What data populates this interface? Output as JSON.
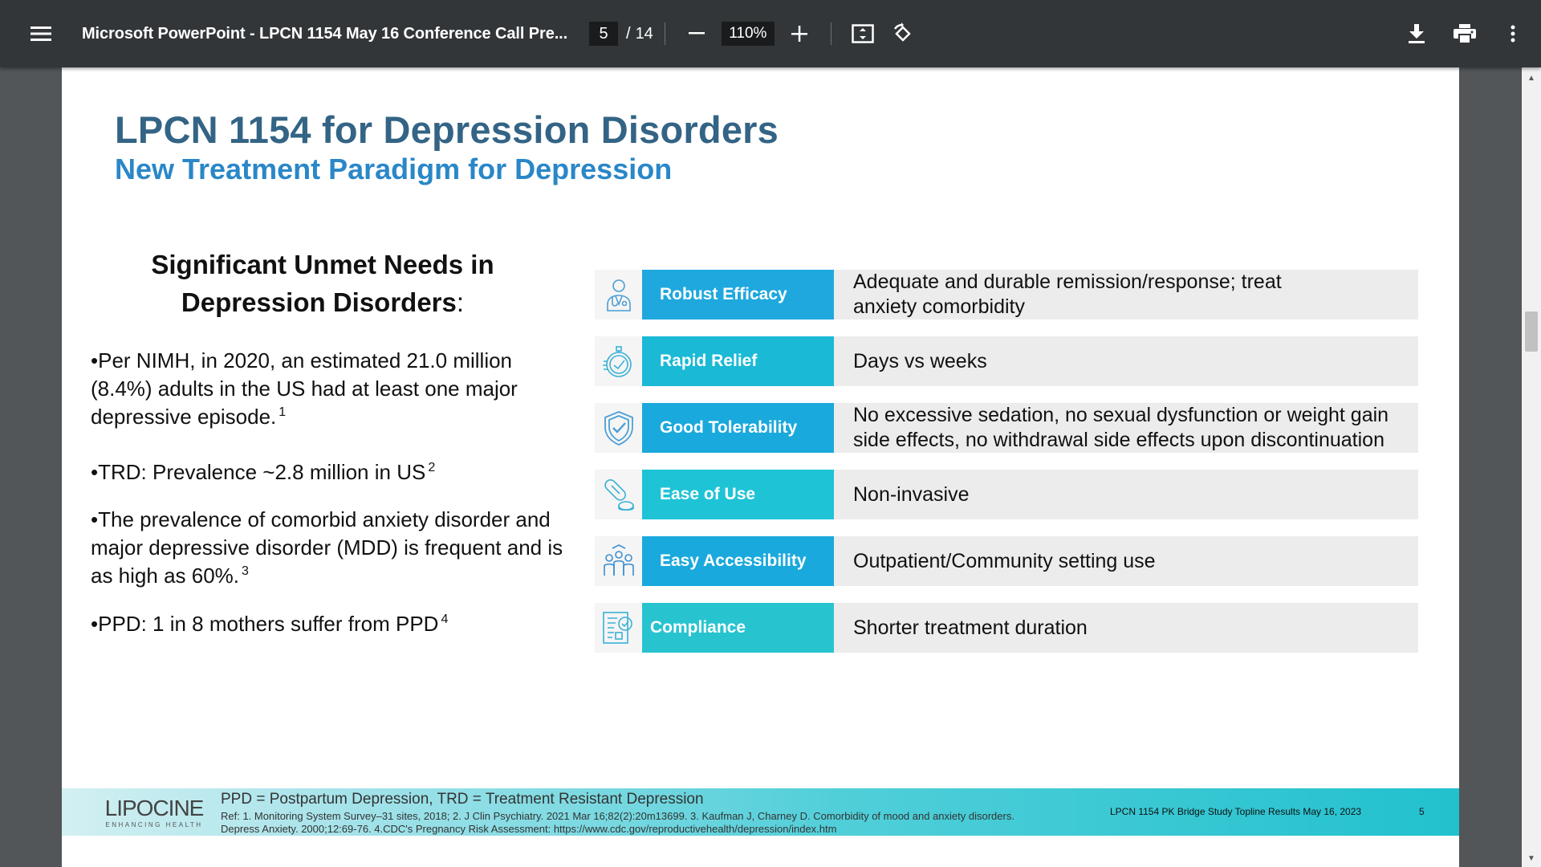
{
  "toolbar": {
    "title": "Microsoft PowerPoint - LPCN 1154 May 16 Conference Call Pre...",
    "page_current": "5",
    "page_separator": "/",
    "page_total": "14",
    "zoom": "110%",
    "icons": [
      "menu-icon",
      "zoom-out-icon",
      "zoom-in-icon",
      "fit-page-icon",
      "rotate-icon",
      "download-icon",
      "print-icon",
      "more-icon"
    ]
  },
  "slide": {
    "title": "LPCN 1154 for Depression Disorders",
    "subtitle": "New Treatment Paradigm for Depression",
    "left_heading_line1": "Significant Unmet Needs in",
    "left_heading_line2": "Depression Disorders",
    "left_heading_colon": ":",
    "bullets": [
      {
        "text": "•Per NIMH, in 2020, an estimated 21.0 million (8.4%) adults in the US had at least one major depressive episode.",
        "sup": "1"
      },
      {
        "text": "•TRD: Prevalence ~2.8 million in US",
        "sup": "2"
      },
      {
        "text": "•The prevalence of comorbid anxiety disorder and major depressive disorder (MDD) is frequent and is as high as 60%.",
        "sup": "3"
      },
      {
        "text": "•PPD: 1 in 8 mothers suffer from PPD",
        "sup": "4"
      }
    ],
    "rows": [
      {
        "icon": "doctor-icon",
        "label": "Robust Efficacy",
        "description": "Adequate and durable remission/response; treat anxiety comorbidity",
        "color": "#1fa8de"
      },
      {
        "icon": "stopwatch-icon",
        "label": "Rapid Relief",
        "description": "Days vs weeks",
        "color": "#1ab9d6"
      },
      {
        "icon": "shield-check-icon",
        "label": "Good Tolerability",
        "description": "No excessive sedation, no sexual dysfunction or weight gain side effects, no withdrawal side effects upon discontinuation",
        "color": "#1aa9dc"
      },
      {
        "icon": "pill-icon",
        "label": "Ease of Use",
        "description": "Non-invasive",
        "color": "#1fc3d6"
      },
      {
        "icon": "people-group-icon",
        "label": "Easy Accessibility",
        "description": "Outpatient/Community setting use",
        "color": "#1aa9dc"
      },
      {
        "icon": "checklist-icon",
        "label": "Compliance",
        "description": "Shorter treatment duration",
        "color": "#27c4d0"
      }
    ],
    "footer": {
      "logo_text": "LIPOCINE",
      "logo_tagline": "ENHANCING HEALTH",
      "abbreviations": "PPD = Postpartum Depression, TRD = Treatment Resistant Depression",
      "references": "Ref: 1. Monitoring System Survey–31 sites, 2018;    2. J Clin Psychiatry. 2021 Mar 16;82(2):20m13699.  3. Kaufman J, Charney D. Comorbidity of mood and anxiety disorders. Depress Anxiety. 2000;12:69-76. 4.CDC's Pregnancy Risk Assessment: https://www.cdc.gov/reproductivehealth/depression/index.htm",
      "study_info": "LPCN 1154 PK Bridge Study Topline Results May 16, 2023",
      "page_number": "5"
    }
  }
}
